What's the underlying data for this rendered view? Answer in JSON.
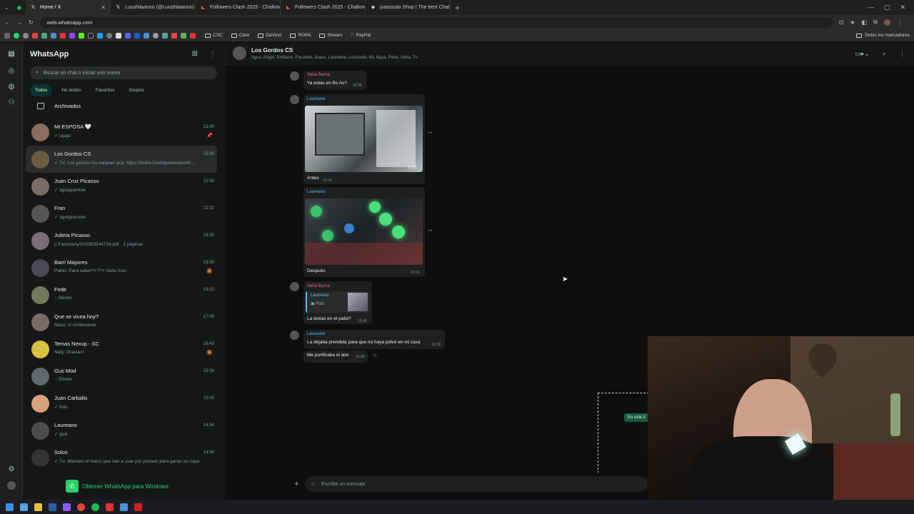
{
  "browser": {
    "tabs": [
      {
        "label": "Home / X",
        "icon": "x-logo-icon",
        "color": "#ffffff",
        "active": true
      },
      {
        "label": "Luushiiaanoo (@Luushiiaanoo)",
        "icon": "x-logo-icon",
        "color": "#ffffff"
      },
      {
        "label": "Followers Clash 2025 - Challonge",
        "icon": "challonge-icon",
        "color": "#e4543a"
      },
      {
        "label": "Followers Clash 2025 - Challonge",
        "icon": "challonge-icon",
        "color": "#e4543a"
      },
      {
        "label": "juanssolo Shop | The best Chat",
        "icon": "shop-icon",
        "color": "#cccccc"
      }
    ],
    "url": "web.whatsapp.com",
    "bookmarks": [
      {
        "label": "CSC",
        "icon": "folder-icon"
      },
      {
        "label": "Clew",
        "icon": "folder-icon"
      },
      {
        "label": "DaVinci",
        "icon": "folder-icon"
      },
      {
        "label": "ROPA",
        "icon": "folder-icon"
      },
      {
        "label": "Stream",
        "icon": "folder-icon"
      },
      {
        "label": "PayPal",
        "icon": "paypal-icon"
      }
    ],
    "all_bookmarks": "Todos los marcadores"
  },
  "sidebar": {
    "title": "WhatsApp",
    "search_placeholder": "Buscar un chat o iniciar uno nuevo",
    "filters": [
      "Todos",
      "No leídos",
      "Favoritos",
      "Grupos"
    ],
    "archived_label": "Archivados",
    "get_app": "Obtener WhatsApp para Windows",
    "chats": [
      {
        "name": "MI ESPOSA 🤍",
        "time": "21:40",
        "preview": "✓ jajaja",
        "icon": "📌",
        "avatar": "#8a6f5e"
      },
      {
        "name": "Los Gordos CS",
        "time": "22:39",
        "preview": "✓ Tú: Los puntos los canjean aca: https://botrix.live/k/juanssolo/sh...",
        "icon": "",
        "avatar": "#6e5a3e",
        "selected": true
      },
      {
        "name": "Juan Cruz Picasso",
        "time": "22:33",
        "preview": "✓ agréguenme",
        "icon": "",
        "avatar": "#7b6a66"
      },
      {
        "name": "Fran",
        "time": "22:32",
        "preview": "✓ agréguenme",
        "icon": "",
        "avatar": "#555555"
      },
      {
        "name": "Julieta Picasso",
        "time": "19:30",
        "preview": "▯ FacturaAySA0583544724.pdf · 2 páginas",
        "icon": "",
        "avatar": "#7a6c78"
      },
      {
        "name": "Barri Mayores",
        "time": "19:30",
        "preview": "Pablo: Para saber?+??+ nada mas",
        "icon": "🔕",
        "avatar": "#4a4a5a"
      },
      {
        "name": "Fede",
        "time": "19:22",
        "preview": "◌ Sticker",
        "icon": "",
        "avatar": "#6d7b5a"
      },
      {
        "name": "Que se vicea hoy?",
        "time": "17:05",
        "preview": "Naza: ni contestaste",
        "icon": "",
        "avatar": "#7b6a66"
      },
      {
        "name": "Temas Nexup - SC",
        "time": "16:43",
        "preview": "Naty: Gracias!",
        "icon": "🔕",
        "avatar": "#d8c040"
      },
      {
        "name": "Gus Mod",
        "time": "15:34",
        "preview": "◌ Sticker",
        "icon": "",
        "avatar": "#5f6a70"
      },
      {
        "name": "Juan Carballo",
        "time": "15:02",
        "preview": "✓ listo",
        "icon": "",
        "avatar": "#d7a27a"
      },
      {
        "name": "Laureano",
        "time": "14:54",
        "preview": "✓ god",
        "icon": "",
        "avatar": "#4c4c4c"
      },
      {
        "name": "Solos",
        "time": "14:34",
        "preview": "✓ Tú: Manden el mazo que van a usar por privado para ganar su cupo",
        "icon": "",
        "avatar": "#333333"
      }
    ]
  },
  "conversation": {
    "group_name": "Los Gordos CS",
    "members": "Agus, Angel, Emiliano, Facundo, Joaco, Laureano, Luchardo, Mi, Naza, Peke, Seba, Tú",
    "messages": {
      "m1_sender": "Seba Barria",
      "m1_text": "Ya estas en Bs As?",
      "m1_time": "16:55",
      "m2_sender": "Laureano",
      "m2_caption": "Antes",
      "m2_time": "13:33",
      "m2_photo_time": "13:33",
      "m3_sender": "Laureano",
      "m3_caption": "Después",
      "m3_time": "13:33",
      "m4_sender": "Seba Barria",
      "m4_quote_sender": "Laureano",
      "m4_quote_label": "Foto",
      "m4_text": "La tenias en el patio?",
      "m4_time": "13:36",
      "m5_sender": "Laureano",
      "m5_text": "La dejaba prendida para que no haya polvo en mi casa",
      "m5_time": "13:36",
      "m6_text": "Me purificaba el aire",
      "m6_time": "13:36"
    },
    "composer_placeholder": "Escribe un mensaje",
    "overlay_button": "En este li"
  },
  "colors": {
    "accent": "#25d366",
    "sender_pink": "#e26a8d",
    "sender_blue": "#53bdeb"
  }
}
